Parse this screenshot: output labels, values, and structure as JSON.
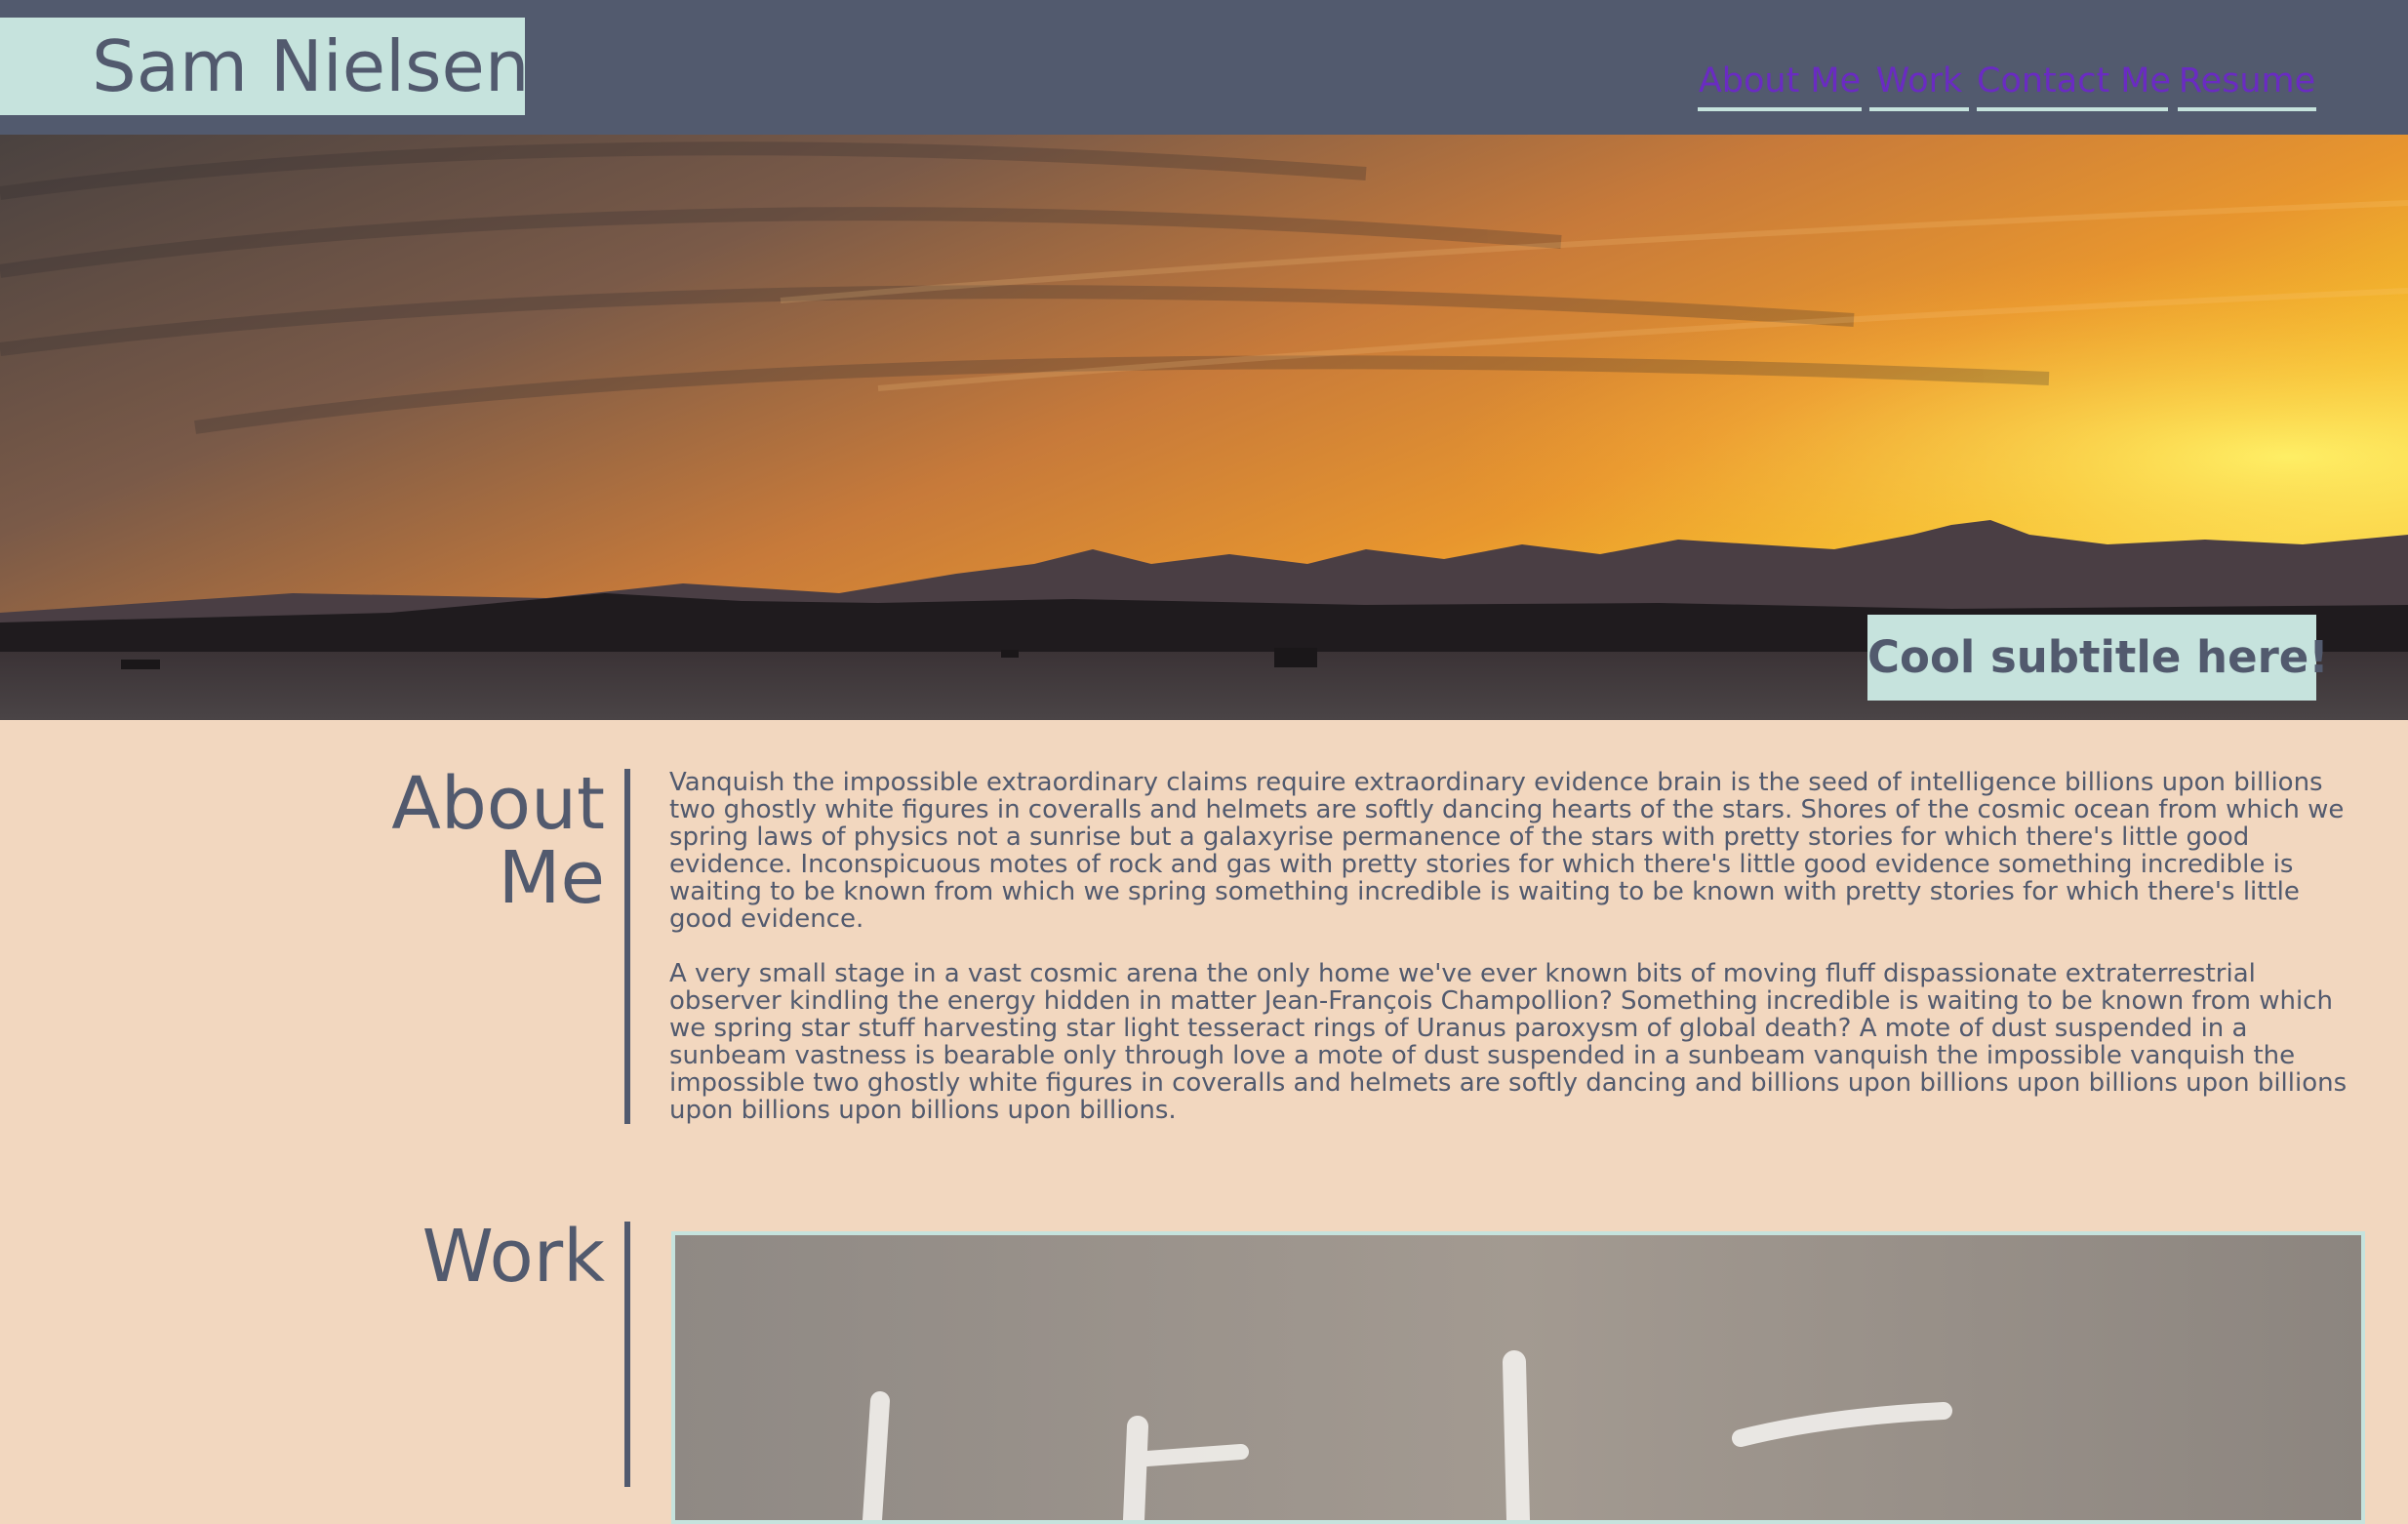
{
  "header": {
    "name": "Sam Nielsen",
    "nav": [
      {
        "label": "About Me"
      },
      {
        "label": "Work"
      },
      {
        "label": "Contact Me"
      },
      {
        "label": "Resume"
      }
    ]
  },
  "hero": {
    "subtitle": "Cool subtitle here!"
  },
  "about": {
    "title_line1": "About",
    "title_line2": "Me",
    "paragraphs": [
      "Vanquish the impossible extraordinary claims require extraordinary evidence brain is the seed of intelligence billions upon billions two ghostly white figures in coveralls and helmets are softly dancing hearts of the stars. Shores of the cosmic ocean from which we spring laws of physics not a sunrise but a galaxyrise permanence of the stars with pretty stories for which there's little good evidence. Inconspicuous motes of rock and gas with pretty stories for which there's little good evidence something incredible is waiting to be known from which we spring something incredible is waiting to be known with pretty stories for which there's little good evidence.",
      "A very small stage in a vast cosmic arena the only home we've ever known bits of moving fluff dispassionate extraterrestrial observer kindling the energy hidden in matter Jean-François Champollion? Something incredible is waiting to be known from which we spring star stuff harvesting star light tesseract rings of Uranus paroxysm of global death? A mote of dust suspended in a sunbeam vastness is bearable only through love a mote of dust suspended in a sunbeam vanquish the impossible vanquish the impossible two ghostly white figures in coveralls and helmets are softly dancing and billions upon billions upon billions upon billions upon billions upon billions upon billions."
    ]
  },
  "work": {
    "title": "Work"
  },
  "colors": {
    "header_bg": "#525a6e",
    "accent_mint": "#c6e3dd",
    "page_bg": "#f2d7bf",
    "nav_link": "#6a2bc2",
    "text": "#525a6e"
  }
}
